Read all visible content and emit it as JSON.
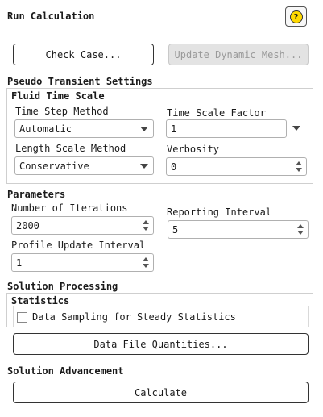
{
  "header": {
    "title": "Run Calculation",
    "help_icon": "question-mark-icon",
    "help_glyph": "?"
  },
  "toolbar": {
    "check_case_label": "Check Case...",
    "update_mesh_label": "Update Dynamic Mesh..."
  },
  "pseudo_transient": {
    "section_title": "Pseudo Transient Settings",
    "fluid_time_scale": {
      "group_title": "Fluid Time Scale",
      "time_step_method": {
        "label": "Time Step Method",
        "value": "Automatic"
      },
      "time_scale_factor": {
        "label": "Time Scale Factor",
        "value": "1"
      },
      "length_scale_method": {
        "label": "Length Scale Method",
        "value": "Conservative"
      },
      "verbosity": {
        "label": "Verbosity",
        "value": "0"
      }
    }
  },
  "parameters": {
    "section_title": "Parameters",
    "number_of_iterations": {
      "label": "Number of Iterations",
      "value": "2000"
    },
    "reporting_interval": {
      "label": "Reporting Interval",
      "value": "5"
    },
    "profile_update_interval": {
      "label": "Profile Update Interval",
      "value": "1"
    }
  },
  "solution_processing": {
    "section_title": "Solution Processing",
    "statistics": {
      "group_title": "Statistics",
      "data_sampling": {
        "label": "Data Sampling for Steady Statistics",
        "checked": false
      }
    },
    "data_file_quantities_label": "Data File Quantities..."
  },
  "solution_advancement": {
    "section_title": "Solution Advancement",
    "calculate_label": "Calculate"
  }
}
